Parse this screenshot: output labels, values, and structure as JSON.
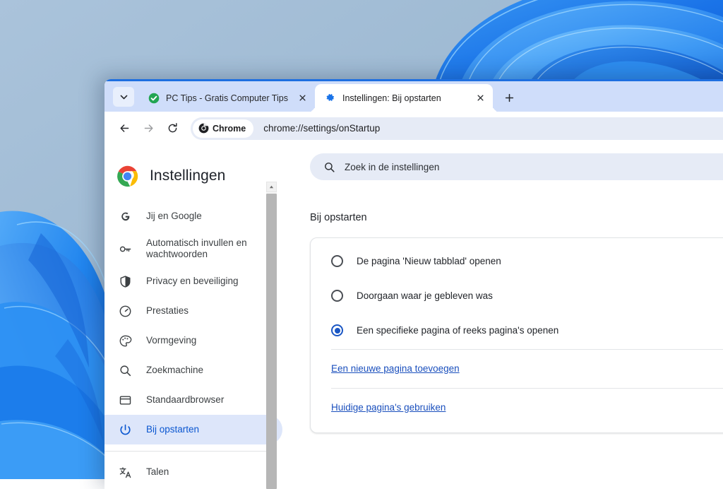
{
  "window": {
    "tab_search_icon": "chevron-down-icon",
    "new_tab_icon": "plus-icon",
    "tabs": [
      {
        "title": "PC Tips - Gratis Computer Tips",
        "favicon": "green-check-circle-icon",
        "close_icon": "close-icon",
        "active": false
      },
      {
        "title": "Instellingen: Bij opstarten",
        "favicon": "blue-gear-icon",
        "close_icon": "close-icon",
        "active": true
      }
    ]
  },
  "toolbar": {
    "back_icon": "arrow-left-icon",
    "forward_icon": "arrow-right-icon",
    "reload_icon": "reload-icon",
    "chip_label": "Chrome",
    "chip_icon": "chrome-logo-icon",
    "url": "chrome://settings/onStartup"
  },
  "settings": {
    "brand_title": "Instellingen",
    "brand_icon": "chrome-logo-icon",
    "search": {
      "placeholder": "Zoek in de instellingen",
      "icon": "search-icon"
    },
    "sidebar": {
      "items": [
        {
          "label": "Jij en Google",
          "icon": "google-g-icon",
          "selected": false
        },
        {
          "label": "Automatisch invullen en wachtwoorden",
          "icon": "key-icon",
          "selected": false
        },
        {
          "label": "Privacy en beveiliging",
          "icon": "shield-icon",
          "selected": false
        },
        {
          "label": "Prestaties",
          "icon": "speedometer-icon",
          "selected": false
        },
        {
          "label": "Vormgeving",
          "icon": "palette-icon",
          "selected": false
        },
        {
          "label": "Zoekmachine",
          "icon": "search-icon",
          "selected": false
        },
        {
          "label": "Standaardbrowser",
          "icon": "browser-window-icon",
          "selected": false
        },
        {
          "label": "Bij opstarten",
          "icon": "power-icon",
          "selected": true
        },
        {
          "label": "Talen",
          "icon": "translate-icon",
          "selected": false
        }
      ],
      "scrollbar": {
        "up_arrow_icon": "caret-up-icon"
      }
    },
    "section_title": "Bij opstarten",
    "startup_options": [
      {
        "label": "De pagina 'Nieuw tabblad' openen",
        "selected": false
      },
      {
        "label": "Doorgaan waar je gebleven was",
        "selected": false
      },
      {
        "label": "Een specifieke pagina of reeks pagina's openen",
        "selected": true
      }
    ],
    "startup_links": [
      {
        "label": "Een nieuwe pagina toevoegen"
      },
      {
        "label": "Huidige pagina's gebruiken"
      }
    ]
  },
  "colors": {
    "accent_blue": "#0b57d0",
    "tabstrip_blue": "#cfddfa",
    "link_blue": "#1a4fbd",
    "selected_pill": "#dde6fa"
  }
}
